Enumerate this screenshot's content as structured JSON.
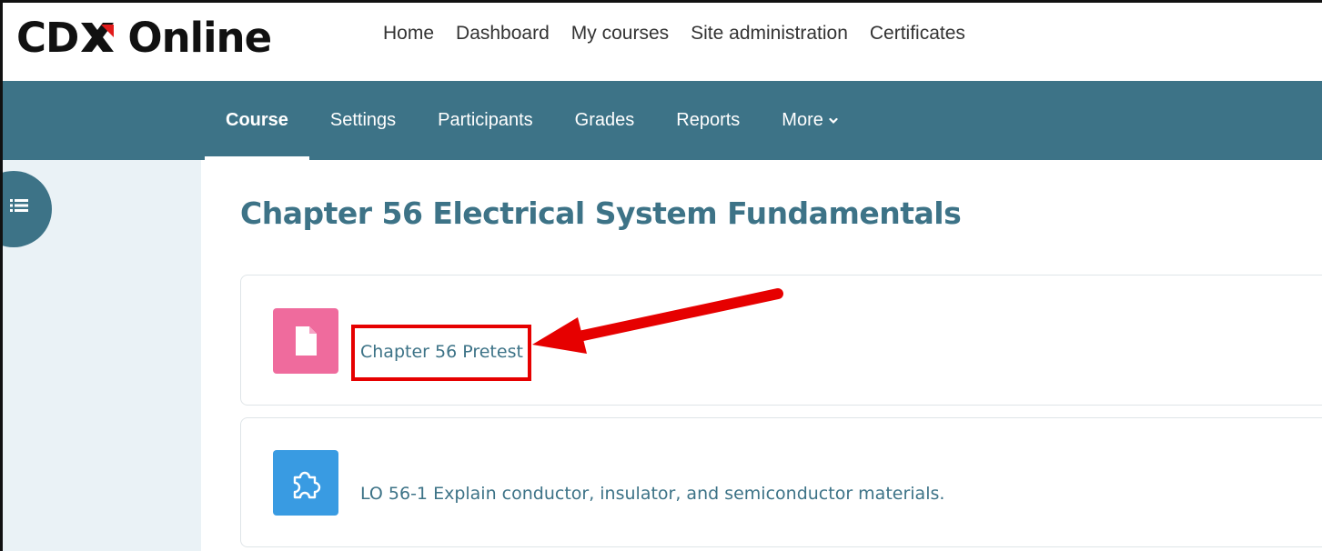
{
  "brand": {
    "logo_part1": "CD",
    "logo_part2": "Online"
  },
  "top_nav": [
    {
      "label": "Home"
    },
    {
      "label": "Dashboard"
    },
    {
      "label": "My courses"
    },
    {
      "label": "Site administration"
    },
    {
      "label": "Certificates"
    }
  ],
  "course_nav": [
    {
      "label": "Course",
      "active": true
    },
    {
      "label": "Settings"
    },
    {
      "label": "Participants"
    },
    {
      "label": "Grades"
    },
    {
      "label": "Reports"
    },
    {
      "label": "More"
    }
  ],
  "page_title": "Chapter 56 Electrical System Fundamentals",
  "activities": [
    {
      "label": "Chapter 56 Pretest",
      "icon": "document-icon",
      "icon_color": "#ef6b9d"
    },
    {
      "label": "LO 56-1 Explain conductor, insulator, and semiconductor materials.",
      "icon": "puzzle-piece-icon",
      "icon_color": "#399be2"
    }
  ],
  "colors": {
    "primary": "#3d7387",
    "highlight": "#e60000",
    "drawer_bg": "#eaf2f6",
    "logo_red": "#e21b1b"
  }
}
